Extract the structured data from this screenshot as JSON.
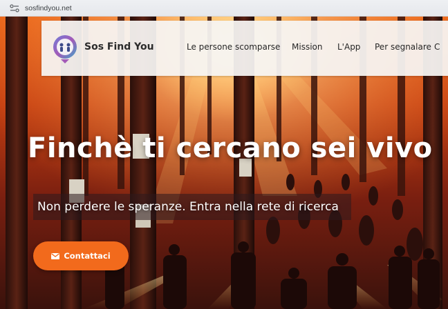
{
  "browser": {
    "url": "sosfindyou.net"
  },
  "nav": {
    "brand": "Sos Find You",
    "items": [
      {
        "label": "Le persone scomparse"
      },
      {
        "label": "Mission"
      },
      {
        "label": "L'App"
      },
      {
        "label": "Per segnalare"
      },
      {
        "label": "C"
      }
    ]
  },
  "hero": {
    "headline": "Finchè ti cercano sei vivo",
    "subtitle": "Non perdere le speranze. Entra nella rete di ricerca",
    "cta_label": "Contattaci"
  },
  "colors": {
    "accent": "#f26a1c",
    "nav_bg": "#f6f4f2",
    "hero_top": "#e8651b",
    "hero_bottom": "#3a120c"
  },
  "icons": {
    "url_tune": "tune-icon",
    "logo": "logo-icon",
    "cta": "mail-icon"
  }
}
